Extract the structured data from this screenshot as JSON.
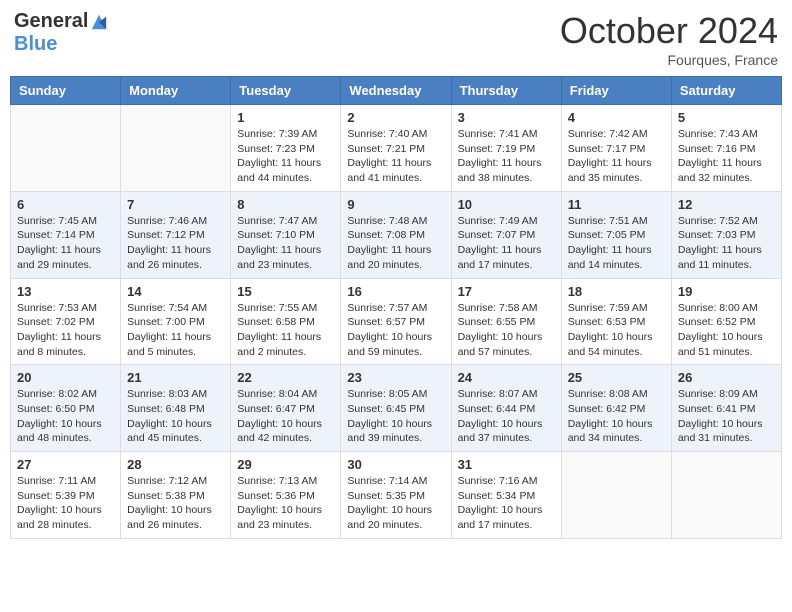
{
  "header": {
    "logo_general": "General",
    "logo_blue": "Blue",
    "month": "October 2024",
    "location": "Fourques, France"
  },
  "days_of_week": [
    "Sunday",
    "Monday",
    "Tuesday",
    "Wednesday",
    "Thursday",
    "Friday",
    "Saturday"
  ],
  "weeks": [
    [
      {
        "day": "",
        "info": ""
      },
      {
        "day": "",
        "info": ""
      },
      {
        "day": "1",
        "info": "Sunrise: 7:39 AM\nSunset: 7:23 PM\nDaylight: 11 hours and 44 minutes."
      },
      {
        "day": "2",
        "info": "Sunrise: 7:40 AM\nSunset: 7:21 PM\nDaylight: 11 hours and 41 minutes."
      },
      {
        "day": "3",
        "info": "Sunrise: 7:41 AM\nSunset: 7:19 PM\nDaylight: 11 hours and 38 minutes."
      },
      {
        "day": "4",
        "info": "Sunrise: 7:42 AM\nSunset: 7:17 PM\nDaylight: 11 hours and 35 minutes."
      },
      {
        "day": "5",
        "info": "Sunrise: 7:43 AM\nSunset: 7:16 PM\nDaylight: 11 hours and 32 minutes."
      }
    ],
    [
      {
        "day": "6",
        "info": "Sunrise: 7:45 AM\nSunset: 7:14 PM\nDaylight: 11 hours and 29 minutes."
      },
      {
        "day": "7",
        "info": "Sunrise: 7:46 AM\nSunset: 7:12 PM\nDaylight: 11 hours and 26 minutes."
      },
      {
        "day": "8",
        "info": "Sunrise: 7:47 AM\nSunset: 7:10 PM\nDaylight: 11 hours and 23 minutes."
      },
      {
        "day": "9",
        "info": "Sunrise: 7:48 AM\nSunset: 7:08 PM\nDaylight: 11 hours and 20 minutes."
      },
      {
        "day": "10",
        "info": "Sunrise: 7:49 AM\nSunset: 7:07 PM\nDaylight: 11 hours and 17 minutes."
      },
      {
        "day": "11",
        "info": "Sunrise: 7:51 AM\nSunset: 7:05 PM\nDaylight: 11 hours and 14 minutes."
      },
      {
        "day": "12",
        "info": "Sunrise: 7:52 AM\nSunset: 7:03 PM\nDaylight: 11 hours and 11 minutes."
      }
    ],
    [
      {
        "day": "13",
        "info": "Sunrise: 7:53 AM\nSunset: 7:02 PM\nDaylight: 11 hours and 8 minutes."
      },
      {
        "day": "14",
        "info": "Sunrise: 7:54 AM\nSunset: 7:00 PM\nDaylight: 11 hours and 5 minutes."
      },
      {
        "day": "15",
        "info": "Sunrise: 7:55 AM\nSunset: 6:58 PM\nDaylight: 11 hours and 2 minutes."
      },
      {
        "day": "16",
        "info": "Sunrise: 7:57 AM\nSunset: 6:57 PM\nDaylight: 10 hours and 59 minutes."
      },
      {
        "day": "17",
        "info": "Sunrise: 7:58 AM\nSunset: 6:55 PM\nDaylight: 10 hours and 57 minutes."
      },
      {
        "day": "18",
        "info": "Sunrise: 7:59 AM\nSunset: 6:53 PM\nDaylight: 10 hours and 54 minutes."
      },
      {
        "day": "19",
        "info": "Sunrise: 8:00 AM\nSunset: 6:52 PM\nDaylight: 10 hours and 51 minutes."
      }
    ],
    [
      {
        "day": "20",
        "info": "Sunrise: 8:02 AM\nSunset: 6:50 PM\nDaylight: 10 hours and 48 minutes."
      },
      {
        "day": "21",
        "info": "Sunrise: 8:03 AM\nSunset: 6:48 PM\nDaylight: 10 hours and 45 minutes."
      },
      {
        "day": "22",
        "info": "Sunrise: 8:04 AM\nSunset: 6:47 PM\nDaylight: 10 hours and 42 minutes."
      },
      {
        "day": "23",
        "info": "Sunrise: 8:05 AM\nSunset: 6:45 PM\nDaylight: 10 hours and 39 minutes."
      },
      {
        "day": "24",
        "info": "Sunrise: 8:07 AM\nSunset: 6:44 PM\nDaylight: 10 hours and 37 minutes."
      },
      {
        "day": "25",
        "info": "Sunrise: 8:08 AM\nSunset: 6:42 PM\nDaylight: 10 hours and 34 minutes."
      },
      {
        "day": "26",
        "info": "Sunrise: 8:09 AM\nSunset: 6:41 PM\nDaylight: 10 hours and 31 minutes."
      }
    ],
    [
      {
        "day": "27",
        "info": "Sunrise: 7:11 AM\nSunset: 5:39 PM\nDaylight: 10 hours and 28 minutes."
      },
      {
        "day": "28",
        "info": "Sunrise: 7:12 AM\nSunset: 5:38 PM\nDaylight: 10 hours and 26 minutes."
      },
      {
        "day": "29",
        "info": "Sunrise: 7:13 AM\nSunset: 5:36 PM\nDaylight: 10 hours and 23 minutes."
      },
      {
        "day": "30",
        "info": "Sunrise: 7:14 AM\nSunset: 5:35 PM\nDaylight: 10 hours and 20 minutes."
      },
      {
        "day": "31",
        "info": "Sunrise: 7:16 AM\nSunset: 5:34 PM\nDaylight: 10 hours and 17 minutes."
      },
      {
        "day": "",
        "info": ""
      },
      {
        "day": "",
        "info": ""
      }
    ]
  ]
}
